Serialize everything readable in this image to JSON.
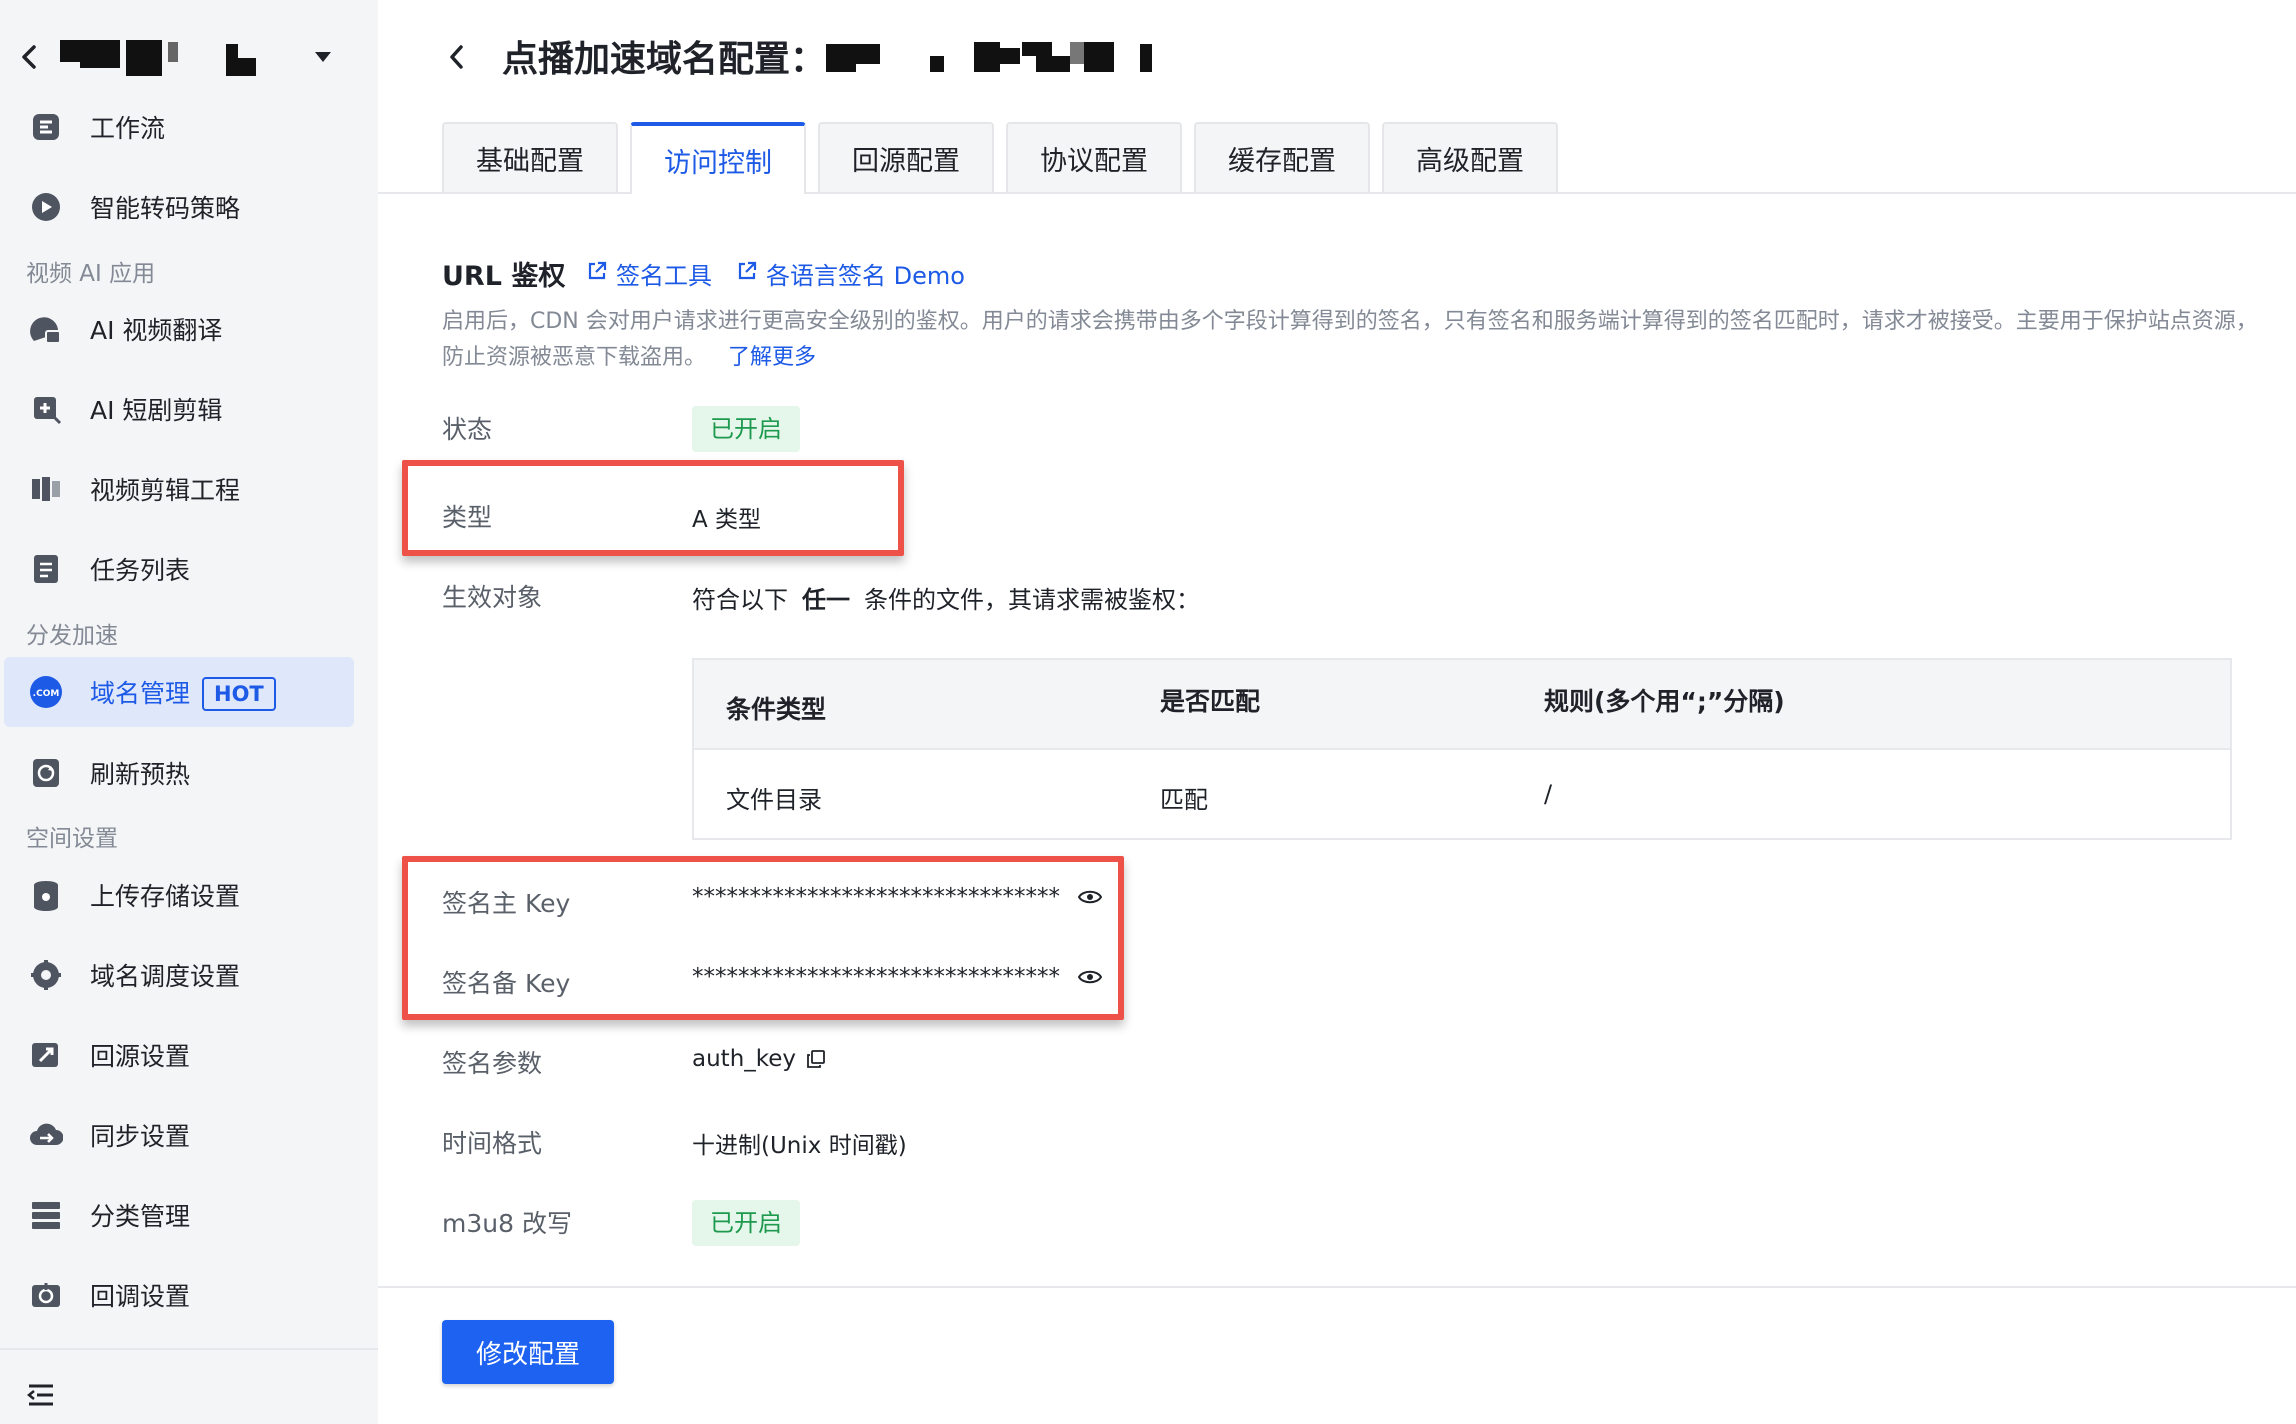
{
  "sidebar": {
    "items": [
      {
        "label": "工作流",
        "icon": "workflow-icon"
      },
      {
        "label": "智能转码策略",
        "icon": "transcode-strategy-icon"
      },
      {
        "label": "AI 视频翻译",
        "icon": "ai-translate-icon"
      },
      {
        "label": "AI 短剧剪辑",
        "icon": "ai-clip-icon"
      },
      {
        "label": "视频剪辑工程",
        "icon": "video-edit-icon"
      },
      {
        "label": "任务列表",
        "icon": "task-list-icon"
      },
      {
        "label": "域名管理",
        "icon": "domain-icon",
        "badge": "HOT"
      },
      {
        "label": "刷新预热",
        "icon": "refresh-icon"
      },
      {
        "label": "上传存储设置",
        "icon": "storage-icon"
      },
      {
        "label": "域名调度设置",
        "icon": "dispatch-icon"
      },
      {
        "label": "回源设置",
        "icon": "origin-icon"
      },
      {
        "label": "同步设置",
        "icon": "sync-icon"
      },
      {
        "label": "分类管理",
        "icon": "category-icon"
      },
      {
        "label": "回调设置",
        "icon": "callback-icon"
      }
    ],
    "groups": [
      "视频 AI 应用",
      "分发加速",
      "空间设置"
    ]
  },
  "header": {
    "title": "点播加速域名配置："
  },
  "tabs": [
    {
      "label": "基础配置"
    },
    {
      "label": "访问控制"
    },
    {
      "label": "回源配置"
    },
    {
      "label": "协议配置"
    },
    {
      "label": "缓存配置"
    },
    {
      "label": "高级配置"
    }
  ],
  "section": {
    "title": "URL 鉴权",
    "link_sign_tool": "签名工具",
    "link_demo": "各语言签名 Demo",
    "description": "启用后，CDN 会对用户请求进行更高安全级别的鉴权。用户的请求会携带由多个字段计算得到的签名，只有签名和服务端计算得到的签名匹配时，请求才被接受。主要用于保护站点资源，防止资源被恶意下载盗用。",
    "learn_more": "了解更多"
  },
  "fields": {
    "status_label": "状态",
    "status_value": "已开启",
    "type_label": "类型",
    "type_value": "A 类型",
    "target_label": "生效对象",
    "target_prefix": "符合以下",
    "target_any": "任一",
    "target_suffix": "条件的文件，其请求需被鉴权：",
    "primary_key_label": "签名主 Key",
    "primary_key_value": "********************************",
    "backup_key_label": "签名备 Key",
    "backup_key_value": "********************************",
    "param_label": "签名参数",
    "param_value": "auth_key",
    "time_label": "时间格式",
    "time_value": "十进制(Unix 时间戳)",
    "m3u8_label": "m3u8 改写",
    "m3u8_value": "已开启"
  },
  "table": {
    "headers": [
      "条件类型",
      "是否匹配",
      "规则(多个用“;”分隔)"
    ],
    "rows": [
      [
        "文件目录",
        "匹配",
        "/"
      ]
    ]
  },
  "actions": {
    "edit": "修改配置"
  },
  "colors": {
    "accent": "#1d5ae6",
    "highlight": "#ee5147",
    "success_bg": "#e5f6ea",
    "success_text": "#1e9a4f"
  }
}
